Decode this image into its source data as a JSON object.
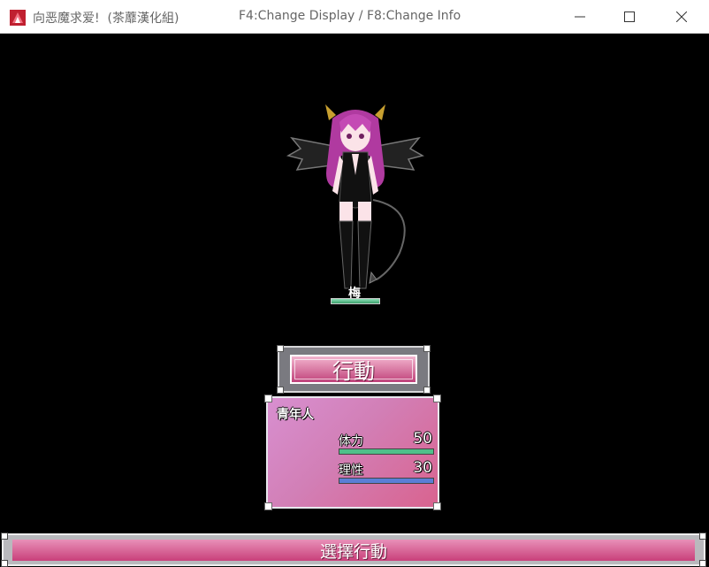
{
  "window": {
    "title": "向恶魔求爱!  (茶蘼漢化組)",
    "hint": "F4:Change Display / F8:Change Info",
    "icon": "game-app-icon",
    "controls": [
      "minimize-icon",
      "maximize-icon",
      "close-icon"
    ]
  },
  "enemy": {
    "name": "梅",
    "hp_fraction": 1.0,
    "sprite": "demon-girl-sprite"
  },
  "command": {
    "label": "行動"
  },
  "status": {
    "title": "青年人",
    "stats": [
      {
        "label": "体力",
        "value": "50",
        "fill": 1.0,
        "color": "#4fc08a"
      },
      {
        "label": "理性",
        "value": "30",
        "fill": 1.0,
        "color": "#5a7fd6"
      }
    ]
  },
  "bottom": {
    "label": "選擇行動"
  },
  "colors": {
    "accent_pink": "#d9638f",
    "frame_gray": "#7a7a80"
  }
}
